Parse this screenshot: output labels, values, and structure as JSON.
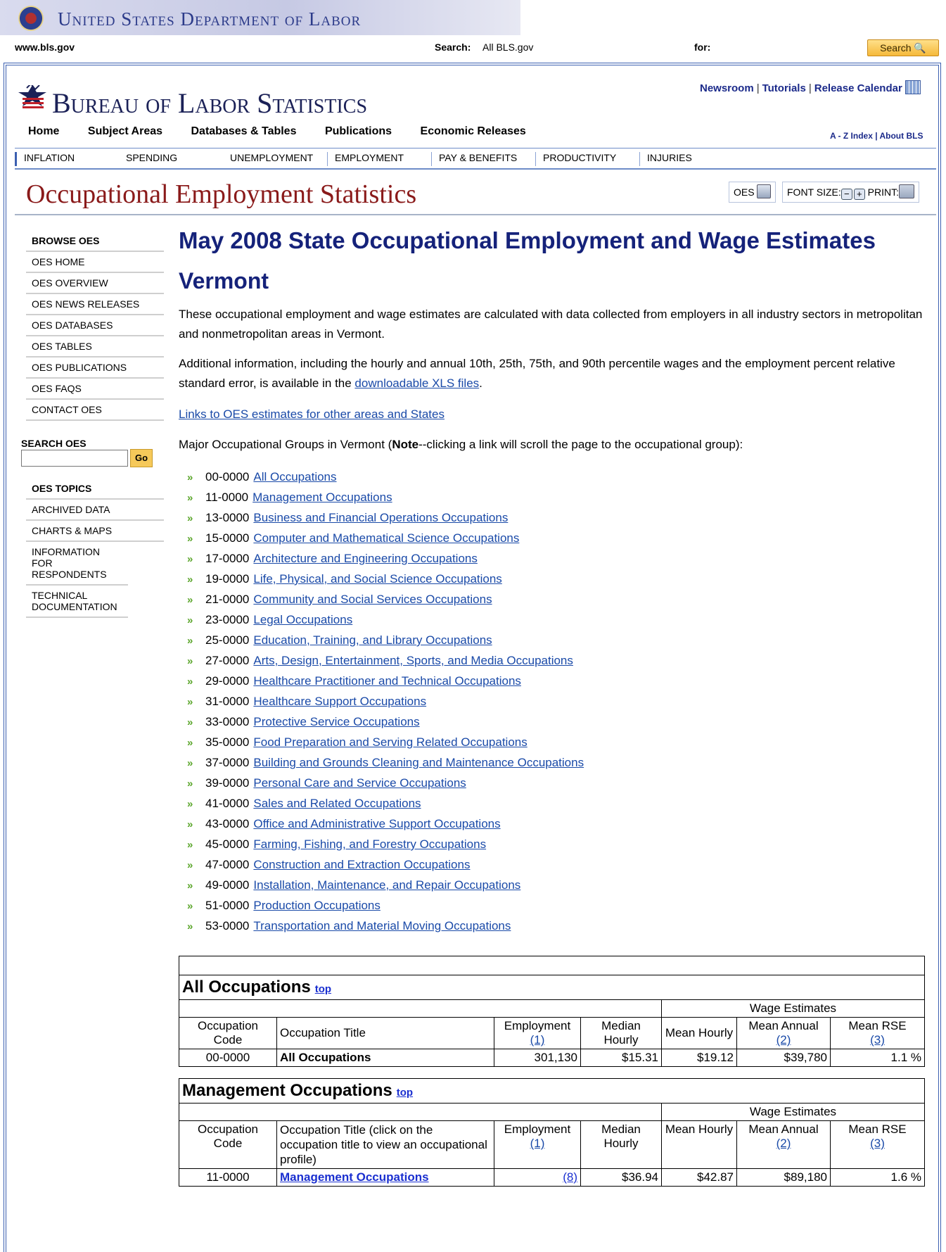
{
  "dol_banner": {
    "title": "United States Department of Labor"
  },
  "top_bar": {
    "site": "www.bls.gov",
    "search_label": "Search:",
    "search_scope": "All BLS.gov",
    "for_label": "for:",
    "search_button": "Search"
  },
  "bls_header": {
    "name": "Bureau of Labor Statistics",
    "links": [
      "Newsroom",
      "Tutorials",
      "Release Calendar"
    ],
    "main_nav": [
      "Home",
      "Subject Areas",
      "Databases & Tables",
      "Publications",
      "Economic Releases"
    ],
    "az_index": "A - Z Index",
    "about": "About BLS",
    "topics": [
      "INFLATION",
      "SPENDING",
      "UNEMPLOYMENT",
      "EMPLOYMENT",
      "PAY & BENEFITS",
      "PRODUCTIVITY",
      "INJURIES"
    ]
  },
  "oes_header": {
    "title": "Occupational Employment Statistics",
    "oes_label": "OES",
    "font_size_label": "FONT SIZE:",
    "print_label": "PRINT:"
  },
  "sidebar": {
    "browse_head": "BROWSE OES",
    "browse_items": [
      "OES HOME",
      "OES OVERVIEW",
      "OES NEWS RELEASES",
      "OES DATABASES",
      "OES TABLES",
      "OES PUBLICATIONS",
      "OES FAQS",
      "CONTACT OES"
    ],
    "search_head": "SEARCH OES",
    "go": "Go",
    "topics_head": "OES TOPICS",
    "topic_items": [
      "ARCHIVED DATA",
      "CHARTS & MAPS",
      "INFORMATION FOR RESPONDENTS",
      "TECHNICAL DOCUMENTATION"
    ]
  },
  "content": {
    "heading": "May 2008 State Occupational Employment and Wage Estimates",
    "state": "Vermont",
    "intro": "These occupational employment and wage estimates are calculated with data collected from employers in all industry sectors in metropolitan and nonmetropolitan areas in Vermont.",
    "additional_prefix": "Additional information, including the hourly and annual 10th, 25th, 75th, and 90th percentile wages and the employment percent relative standard error, is available in the ",
    "xls_link": "downloadable XLS files",
    "additional_suffix": ".",
    "other_areas_link": "Links to OES estimates for other areas and States",
    "groups_prefix": "Major Occupational Groups in Vermont (",
    "groups_note": "Note",
    "groups_suffix": "--clicking a link will scroll the page to the occupational group):",
    "groups": [
      {
        "code": "00-0000",
        "title": "All Occupations"
      },
      {
        "code": "11-0000",
        "title": "Management Occupations"
      },
      {
        "code": "13-0000",
        "title": "Business and Financial Operations Occupations"
      },
      {
        "code": "15-0000",
        "title": "Computer and Mathematical Science Occupations"
      },
      {
        "code": "17-0000",
        "title": "Architecture and Engineering Occupations"
      },
      {
        "code": "19-0000",
        "title": "Life, Physical, and Social Science Occupations"
      },
      {
        "code": "21-0000",
        "title": "Community and Social Services Occupations"
      },
      {
        "code": "23-0000",
        "title": "Legal Occupations"
      },
      {
        "code": "25-0000",
        "title": "Education, Training, and Library Occupations"
      },
      {
        "code": "27-0000",
        "title": "Arts, Design, Entertainment, Sports, and Media Occupations"
      },
      {
        "code": "29-0000",
        "title": "Healthcare Practitioner and Technical Occupations"
      },
      {
        "code": "31-0000",
        "title": "Healthcare Support Occupations"
      },
      {
        "code": "33-0000",
        "title": "Protective Service Occupations"
      },
      {
        "code": "35-0000",
        "title": "Food Preparation and Serving Related Occupations"
      },
      {
        "code": "37-0000",
        "title": "Building and Grounds Cleaning and Maintenance Occupations"
      },
      {
        "code": "39-0000",
        "title": "Personal Care and Service Occupations"
      },
      {
        "code": "41-0000",
        "title": "Sales and Related Occupations"
      },
      {
        "code": "43-0000",
        "title": "Office and Administrative Support Occupations"
      },
      {
        "code": "45-0000",
        "title": "Farming, Fishing, and Forestry Occupations"
      },
      {
        "code": "47-0000",
        "title": "Construction and Extraction Occupations"
      },
      {
        "code": "49-0000",
        "title": "Installation, Maintenance, and Repair Occupations"
      },
      {
        "code": "51-0000",
        "title": "Production Occupations"
      },
      {
        "code": "53-0000",
        "title": "Transportation and Material Moving Occupations"
      }
    ]
  },
  "tables": {
    "top_link": "top",
    "wage_estimates": "Wage Estimates",
    "headers": {
      "code": "Occupation Code",
      "employment": "Employment",
      "employment_ref": "(1)",
      "median_hourly": "Median Hourly",
      "mean_hourly": "Mean Hourly",
      "mean_annual": "Mean Annual",
      "mean_annual_ref": "(2)",
      "mean_rse": "Mean RSE",
      "mean_rse_ref": "(3)"
    },
    "all": {
      "title": "All Occupations",
      "title_header": "Occupation Title",
      "row": {
        "code": "00-0000",
        "title": "All Occupations",
        "employment": "301,130",
        "median_hourly": "$15.31",
        "mean_hourly": "$19.12",
        "mean_annual": "$39,780",
        "mean_rse": "1.1 %"
      }
    },
    "management": {
      "title": "Management Occupations",
      "title_header": "Occupation Title (click on the occupation title to view an occupational profile)",
      "row": {
        "code": "11-0000",
        "title": "Management Occupations",
        "employment": "(8)",
        "median_hourly": "$36.94",
        "mean_hourly": "$42.87",
        "mean_annual": "$89,180",
        "mean_rse": "1.6 %"
      }
    }
  }
}
